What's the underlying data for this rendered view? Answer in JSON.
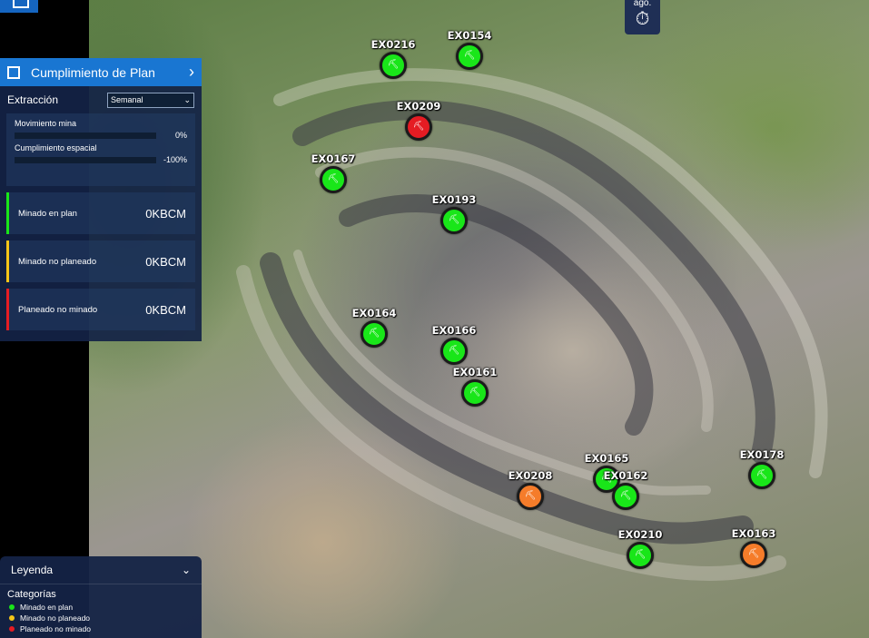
{
  "colors": {
    "green": "#19e619",
    "red": "#e51c23",
    "orange": "#f57c2a",
    "yellow": "#f5c518",
    "panel_blue": "#1976d2"
  },
  "timer": {
    "text": "ago.",
    "icon": "timer-icon"
  },
  "plan_panel": {
    "title": "Cumplimiento de Plan",
    "chevron_icon": "chevron-right-icon",
    "label": "Extracción",
    "period": {
      "selected": "Semanal"
    },
    "metrics": [
      {
        "label": "Movimiento mina",
        "value": "0%"
      },
      {
        "label": "Cumplimiento espacial",
        "value": "-100%"
      }
    ],
    "cards": [
      {
        "label": "Minado en plan",
        "value": "0KBCM",
        "color": "#19e619"
      },
      {
        "label": "Minado no planeado",
        "value": "0KBCM",
        "color": "#f5c518"
      },
      {
        "label": "Planeado no minado",
        "value": "0KBCM",
        "color": "#e51c23"
      }
    ]
  },
  "legend": {
    "title": "Leyenda",
    "categories_title": "Categorías",
    "items": [
      {
        "label": "Minado en plan",
        "color": "#19e619"
      },
      {
        "label": "Minado no planeado",
        "color": "#f5c518"
      },
      {
        "label": "Planeado no minado",
        "color": "#e51c23"
      }
    ]
  },
  "markers": [
    {
      "id": "EX0216",
      "status": "green"
    },
    {
      "id": "EX0154",
      "status": "green"
    },
    {
      "id": "EX0209",
      "status": "red"
    },
    {
      "id": "EX0167",
      "status": "green"
    },
    {
      "id": "EX0193",
      "status": "green"
    },
    {
      "id": "EX0164",
      "status": "green"
    },
    {
      "id": "EX0166",
      "status": "green"
    },
    {
      "id": "EX0161",
      "status": "green"
    },
    {
      "id": "EX0165",
      "status": "green"
    },
    {
      "id": "EX0162",
      "status": "green"
    },
    {
      "id": "EX0208",
      "status": "orange"
    },
    {
      "id": "EX0178",
      "status": "green"
    },
    {
      "id": "EX0210",
      "status": "green"
    },
    {
      "id": "EX0163",
      "status": "orange"
    }
  ]
}
